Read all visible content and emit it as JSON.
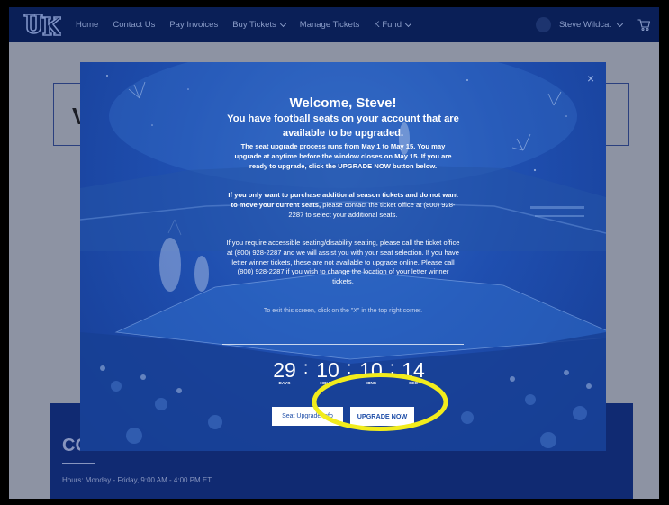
{
  "nav": {
    "items": [
      {
        "label": "Home"
      },
      {
        "label": "Contact Us"
      },
      {
        "label": "Pay Invoices"
      },
      {
        "label": "Buy Tickets",
        "dropdown": true
      },
      {
        "label": "Manage Tickets"
      },
      {
        "label": "K Fund",
        "dropdown": true
      }
    ],
    "user_name": "Steve Wildcat",
    "logo_icon": "uk-logo",
    "cart_icon": "cart-icon"
  },
  "background_page": {
    "card_letter": "V",
    "contact_heading": "CO",
    "contact_hours": "Hours: Monday - Friday, 9:00 AM - 4:00 PM ET"
  },
  "modal": {
    "close": "×",
    "welcome": "Welcome, Steve!",
    "lead": "You have football seats on your account that are available to be upgraded.",
    "p1": "The seat upgrade process runs from May 1 to May 15. You may upgrade at anytime before the window closes on May 15. If you are ready to upgrade, click the UPGRADE NOW button below.",
    "p2_bold": "If you only want to purchase additional season tickets and do not want to move your current seats,",
    "p2_rest": " please contact the ticket office at (800) 928-2287 to select your additional seats.",
    "p3": "If you require accessible seating/disability seating, please call the ticket office at (800) 928-2287 and we will assist you with your seat selection. If you have letter winner tickets, these are not available to upgrade online. Please call (800) 928-2287 if you wish to change the location of your letter winner tickets.",
    "p4": "To exit this screen, click on the \"X\" in the top right corner.",
    "countdown": {
      "days": "29",
      "days_label": "DAYS",
      "hours": "10",
      "hours_label": "HOURS",
      "mins": "10",
      "mins_label": "MINS",
      "secs": "14",
      "secs_label": "SEC",
      "sep": ":"
    },
    "btn_info": "Seat Upgrade Info",
    "btn_upgrade": "UPGRADE NOW"
  },
  "colors": {
    "nav_bg": "#0a1f57",
    "modal_blue": "#1f4fb0",
    "highlight": "#f2ec1c"
  }
}
